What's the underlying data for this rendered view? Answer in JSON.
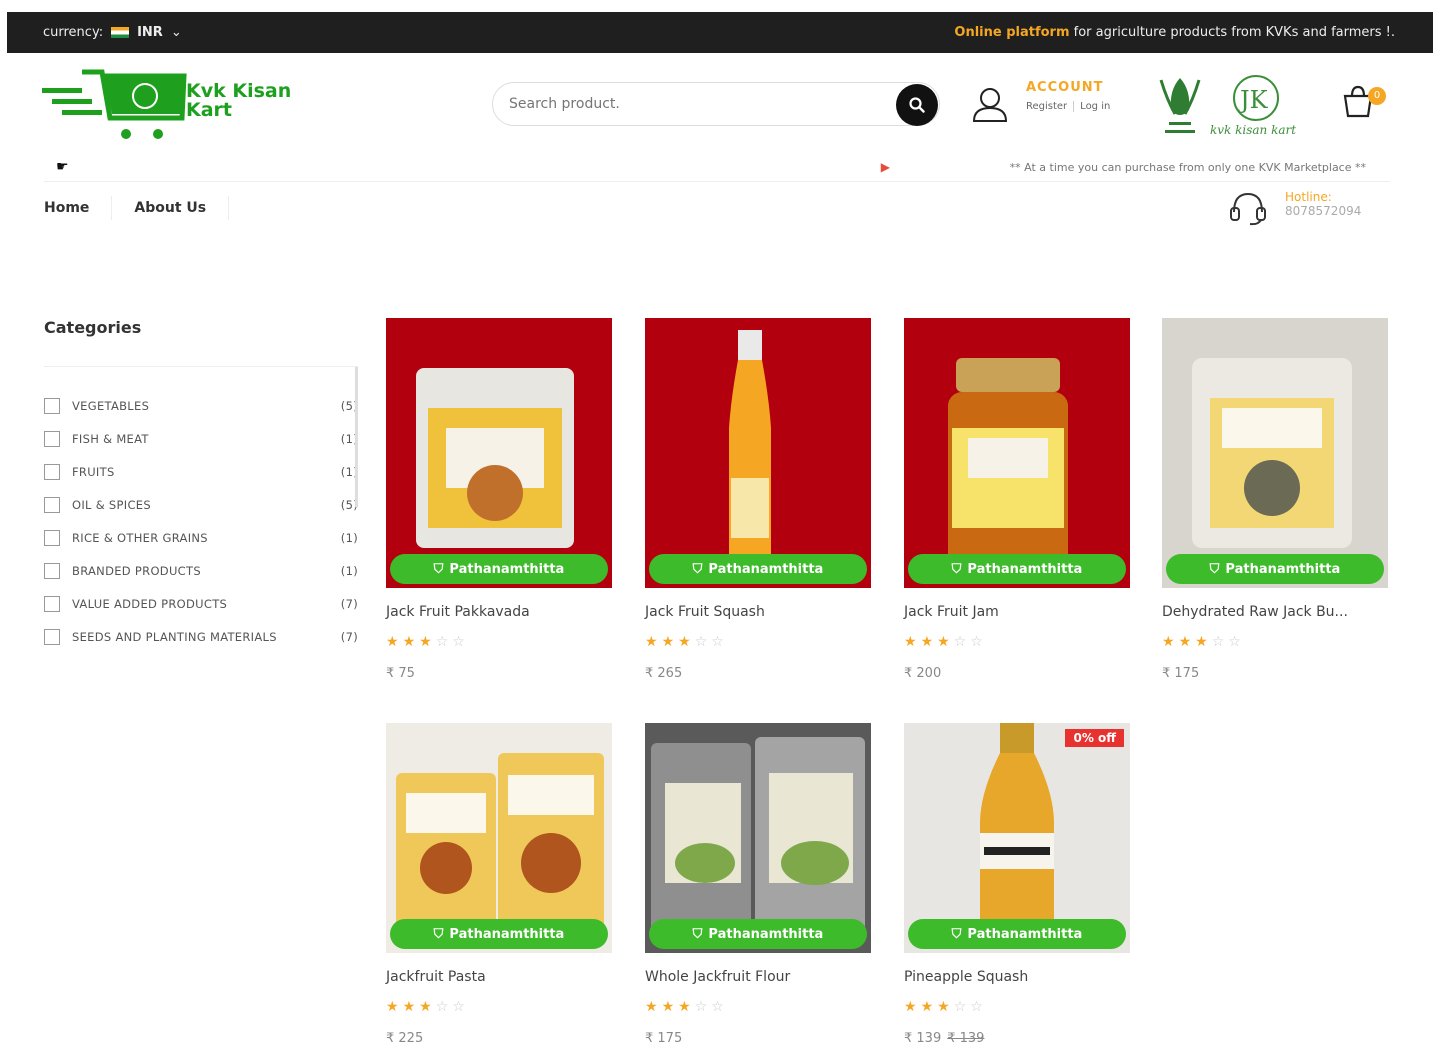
{
  "topbar": {
    "currency_label": "currency:",
    "currency_value": "INR",
    "tagline_strong": "Online platform",
    "tagline_rest": "for agriculture products from KVKs and farmers !."
  },
  "logo": {
    "line1": "Kvk Kisan",
    "line2": "Kart"
  },
  "search": {
    "placeholder": "Search product."
  },
  "account": {
    "title": "ACCOUNT",
    "register": "Register",
    "login": "Log in"
  },
  "cart": {
    "count": "0"
  },
  "notice": {
    "message": "** At a time you can purchase from only one KVK Marketplace **"
  },
  "nav": {
    "home": "Home",
    "about": "About Us"
  },
  "hotline": {
    "label": "Hotline:",
    "number": "8078572094"
  },
  "categories": {
    "title": "Categories",
    "items": [
      {
        "name": "VEGETABLES",
        "count": "(5)"
      },
      {
        "name": "FISH & MEAT",
        "count": "(1)"
      },
      {
        "name": "FRUITS",
        "count": "(1)"
      },
      {
        "name": "OIL & SPICES",
        "count": "(5)"
      },
      {
        "name": "RICE & OTHER GRAINS",
        "count": "(1)"
      },
      {
        "name": "BRANDED PRODUCTS",
        "count": "(1)"
      },
      {
        "name": "VALUE ADDED PRODUCTS",
        "count": "(7)"
      },
      {
        "name": "SEEDS AND PLANTING MATERIALS",
        "count": "(7)"
      }
    ]
  },
  "products": [
    {
      "name": "Jack Fruit Pakkavada",
      "kvk": "Pathanamthitta",
      "price": "₹ 75",
      "rating": 3
    },
    {
      "name": "Jack Fruit Squash",
      "kvk": "Pathanamthitta",
      "price": "₹ 265",
      "rating": 3
    },
    {
      "name": "Jack Fruit Jam",
      "kvk": "Pathanamthitta",
      "price": "₹ 200",
      "rating": 3
    },
    {
      "name": "Dehydrated Raw Jack Bu...",
      "kvk": "Pathanamthitta",
      "price": "₹ 175",
      "rating": 3
    },
    {
      "name": "Jackfruit Pasta",
      "kvk": "Pathanamthitta",
      "price": "₹ 225",
      "rating": 3
    },
    {
      "name": "Whole Jackfruit Flour",
      "kvk": "Pathanamthitta",
      "price": "₹ 175",
      "rating": 3
    },
    {
      "name": "Pineapple Squash",
      "kvk": "Pathanamthitta",
      "price": "₹ 139",
      "old_price": "₹ 139",
      "sale": "0% off",
      "rating": 3
    }
  ],
  "colors": {
    "accent": "#f5a623",
    "brand_green": "#3dbb2a",
    "topbar": "#1f1f1f",
    "sale": "#e8322f"
  },
  "icons": [
    "search-icon",
    "user-icon",
    "cart-icon",
    "hand-icon",
    "headset-icon",
    "bag-icon",
    "star-icon"
  ]
}
